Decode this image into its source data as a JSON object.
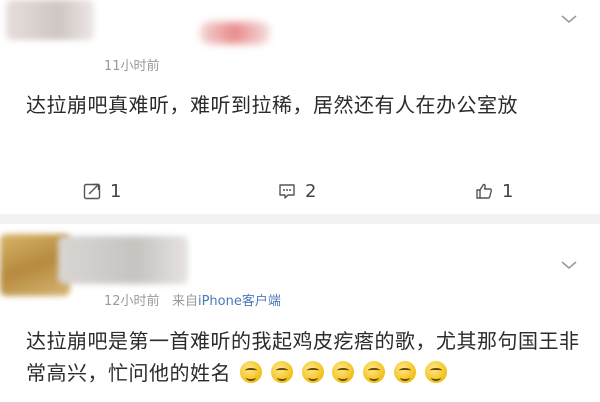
{
  "posts": [
    {
      "time": "11小时前",
      "content": "达拉崩吧真难听，难听到拉稀，居然还有人在办公室放",
      "actions": {
        "forward": "1",
        "comment": "2",
        "like": "1"
      }
    },
    {
      "time": "12小时前",
      "source_prefix": "来自",
      "source_link": "iPhone客户端",
      "content": "达拉崩吧是第一首难听的我起鸡皮疙瘩的歌，尤其那句国王非常高兴，忙问他的姓名"
    }
  ]
}
